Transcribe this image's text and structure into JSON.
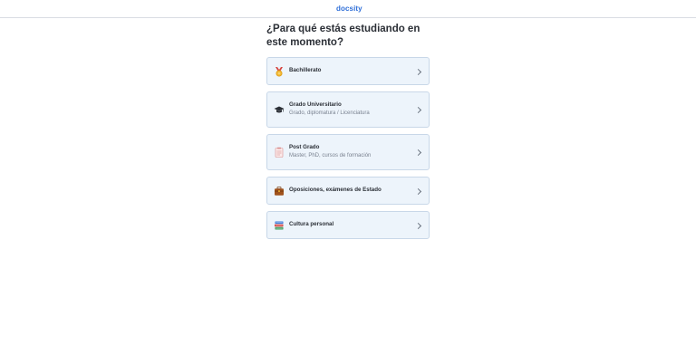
{
  "header": {
    "logo_text": "docsity"
  },
  "question": {
    "title": "¿Para qué estás estudiando en este momento?"
  },
  "options": [
    {
      "label": "Bachillerato",
      "sub": "",
      "icon": "medal-icon"
    },
    {
      "label": "Grado Universitario",
      "sub": "Grado, diplomatura / Licenciatura",
      "icon": "graduation-cap-icon"
    },
    {
      "label": "Post Grado",
      "sub": "Master, PhD, cursos de formación",
      "icon": "clipboard-icon"
    },
    {
      "label": "Oposiciones, exámenes de Estado",
      "sub": "",
      "icon": "briefcase-icon"
    },
    {
      "label": "Cultura personal",
      "sub": "",
      "icon": "books-icon"
    }
  ],
  "colors": {
    "brand": "#2f6fd8",
    "option_bg": "#edf4fb",
    "option_border": "#c8d7e8"
  }
}
